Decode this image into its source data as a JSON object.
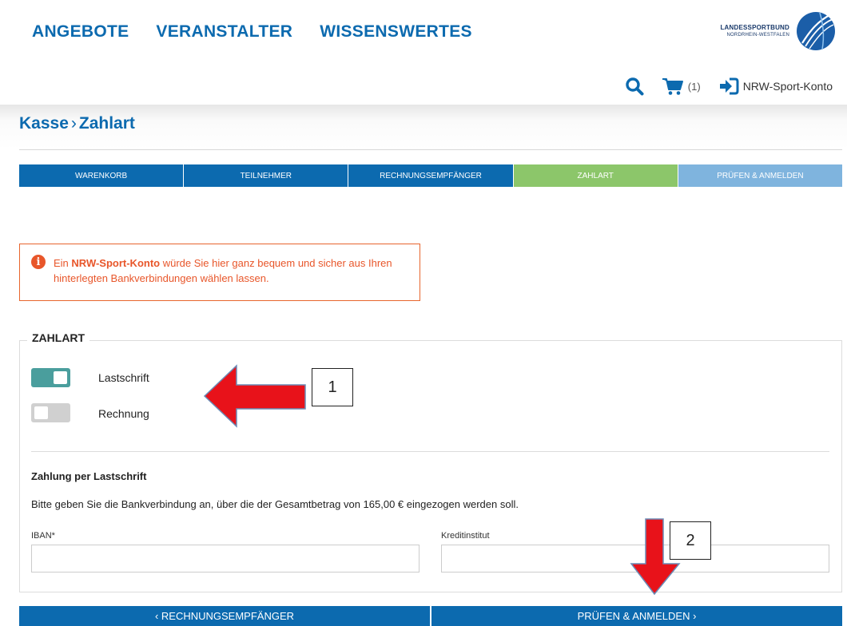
{
  "nav": [
    "ANGEBOTE",
    "VERANSTALTER",
    "WISSENSWERTES"
  ],
  "logo": {
    "line1": "LANDESSPORTBUND",
    "line2": "NORDRHEIN-WESTFALEN"
  },
  "utility": {
    "cart_count": "(1)",
    "account_label": "NRW-Sport-Konto"
  },
  "breadcrumb": {
    "parent": "Kasse",
    "separator": "›",
    "current": "Zahlart"
  },
  "steps": [
    {
      "label": "WARENKORB",
      "color": "#0c6aaf"
    },
    {
      "label": "TEILNEHMER",
      "color": "#0c6aaf"
    },
    {
      "label": "RECHNUNGSEMPFÄNGER",
      "color": "#0c6aaf"
    },
    {
      "label": "ZAHLART",
      "color": "#8cc66a"
    },
    {
      "label": "PRÜFEN & ANMELDEN",
      "color": "#7fb4de"
    }
  ],
  "info": {
    "prefix": "Ein ",
    "highlight": "NRW-Sport-Konto",
    "rest": " würde Sie hier ganz bequem und sicher aus Ihren hinterlegten Bankverbindungen wählen lassen."
  },
  "payment": {
    "legend": "ZAHLART",
    "options": [
      {
        "label": "Lastschrift",
        "active": true
      },
      {
        "label": "Rechnung",
        "active": false
      }
    ],
    "section_title": "Zahlung per Lastschrift",
    "description": "Bitte geben Sie die Bankverbindung an, über die der Gesamtbetrag von 165,00 € eingezogen werden soll.",
    "iban_label": "IBAN*",
    "iban_value": "",
    "bank_label": "Kreditinstitut",
    "bank_value": ""
  },
  "buttons": {
    "back": "‹ RECHNUNGSEMPFÄNGER",
    "next": "PRÜFEN & ANMELDEN ›"
  },
  "annotations": [
    "1",
    "2"
  ],
  "colors": {
    "brand_blue": "#0c6aaf",
    "active_step": "#8cc66a",
    "toggle_on": "#4a9e9d",
    "warning": "#e8562a",
    "arrow_red": "#e8121a"
  }
}
